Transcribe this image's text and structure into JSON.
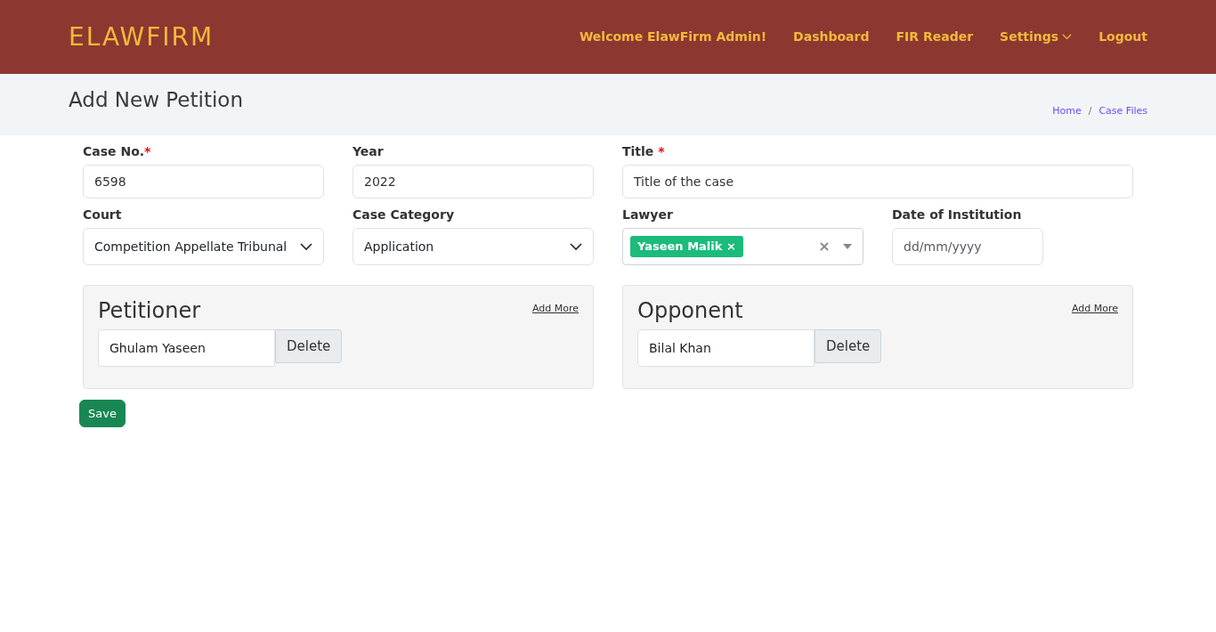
{
  "brand": "ELAWFIRM",
  "nav": [
    {
      "label": "Welcome ElawFirm Admin!",
      "dropdown": false
    },
    {
      "label": "Dashboard",
      "dropdown": false
    },
    {
      "label": "FIR Reader",
      "dropdown": false
    },
    {
      "label": "Settings",
      "dropdown": true
    },
    {
      "label": "Logout",
      "dropdown": false
    }
  ],
  "page_title": "Add New Petition",
  "breadcrumb": [
    "Home",
    "Case Files"
  ],
  "breadcrumb_separator": "/",
  "fields": [
    {
      "kind": "text",
      "label": "Case No.",
      "required_mark": "*",
      "value": "6598"
    },
    {
      "kind": "text",
      "label": "Year",
      "value": "2022"
    },
    {
      "kind": "text",
      "label": "Title",
      "required_mark": "*",
      "value": "Title of the case"
    },
    {
      "kind": "select",
      "label": "Court",
      "value": "Competition Appellate Tribunal"
    },
    {
      "kind": "select",
      "label": "Case Category",
      "value": "Application"
    },
    {
      "kind": "tags",
      "label": "Lawyer",
      "tags": [
        {
          "label": "Yaseen Malik",
          "remove": "×"
        }
      ]
    },
    {
      "kind": "date",
      "label": "Date of Institution",
      "placeholder": "dd/mm/yyyy"
    }
  ],
  "parties": [
    {
      "title": "Petitioner",
      "add_more": "Add More",
      "entries": [
        {
          "value": "Ghulam Yaseen",
          "delete": "Delete"
        }
      ]
    },
    {
      "title": "Opponent",
      "add_more": "Add More",
      "entries": [
        {
          "value": "Bilal Khan",
          "delete": "Delete"
        }
      ]
    }
  ],
  "save": "Save"
}
